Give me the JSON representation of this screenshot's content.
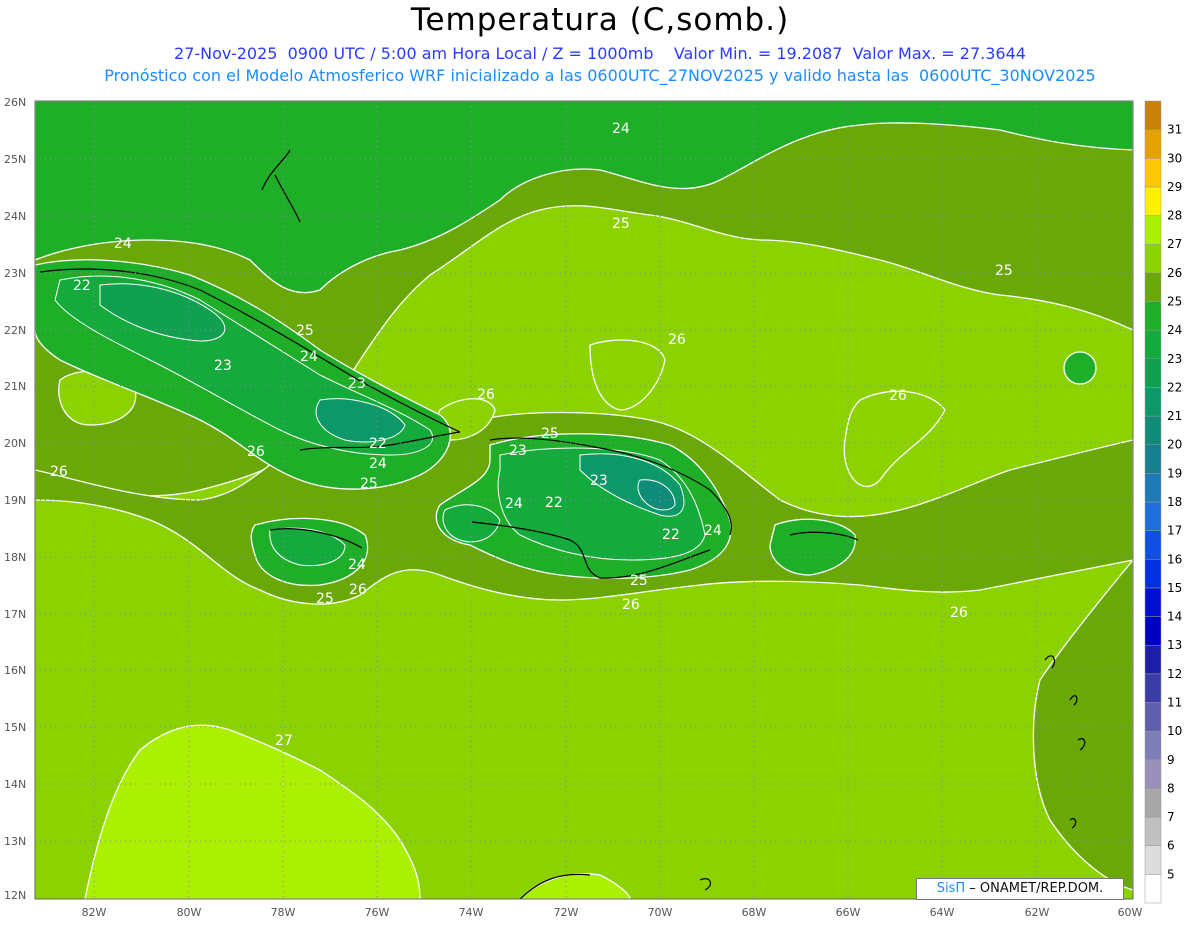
{
  "header": {
    "title": "Temperatura (C,somb.)",
    "line1": "27-Nov-2025  0900 UTC / 5:00 am Hora Local / Z = 1000mb    Valor Min. = 19.2087  Valor Max. = 27.3644",
    "line2": "Pronóstico con el Modelo Atmosferico WRF inicializado a las 0600UTC_27NOV2025 y valido hasta las  0600UTC_30NOV2025"
  },
  "axes": {
    "lat_labels": [
      "26N",
      "25N",
      "24N",
      "23N",
      "22N",
      "21N",
      "20N",
      "19N",
      "18N",
      "17N",
      "16N",
      "15N",
      "14N",
      "13N",
      "12N"
    ],
    "lon_labels": [
      "82W",
      "80W",
      "78W",
      "76W",
      "74W",
      "72W",
      "70W",
      "68W",
      "66W",
      "64W",
      "62W",
      "60W"
    ]
  },
  "colorbar": {
    "levels": [
      "5",
      "6",
      "7",
      "8",
      "9",
      "10",
      "11",
      "12",
      "13",
      "14",
      "15",
      "16",
      "17",
      "18",
      "19",
      "20",
      "21",
      "22",
      "23",
      "24",
      "25",
      "26",
      "27",
      "28",
      "29",
      "30",
      "31"
    ],
    "colors": {
      "lt5": "#ffffff",
      "5": "#dcdcdc",
      "6": "#c0c0c0",
      "7": "#a8a8a8",
      "8": "#9a8fb8",
      "9": "#7d7db8",
      "10": "#5f5fae",
      "11": "#3c3ca8",
      "12": "#1e1ea8",
      "13": "#0000c0",
      "14": "#0010d0",
      "15": "#0030e0",
      "16": "#1050e0",
      "17": "#1e6edc",
      "18": "#1e7ab4",
      "19": "#148090",
      "20": "#0f8c78",
      "21": "#0c9868",
      "22": "#10a050",
      "23": "#14aa3c",
      "24": "#1eae28",
      "25": "#6aa808",
      "26": "#8cd200",
      "27": "#aaf000",
      "28": "#fff000",
      "29": "#ffc800",
      "30": "#e6a000",
      "31": "#c8820a"
    }
  },
  "contour_labels": [
    "24",
    "22",
    "25",
    "24",
    "23",
    "23",
    "22",
    "24",
    "25",
    "26",
    "24",
    "25",
    "26",
    "26",
    "26",
    "25",
    "23",
    "22",
    "24",
    "23",
    "22",
    "24",
    "25",
    "26",
    "24",
    "25",
    "26",
    "26",
    "26",
    "25",
    "27"
  ],
  "credit": {
    "brand": "SisΠ",
    "text": " – ONAMET/REP.DOM."
  }
}
